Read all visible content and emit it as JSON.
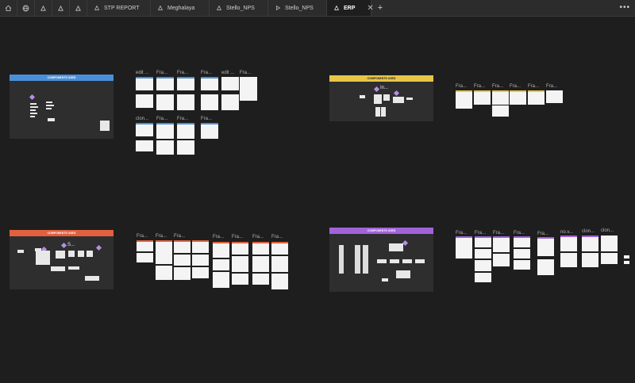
{
  "tabbar": {
    "icons": [
      "home-icon",
      "globe-icon",
      "figma-file-icon",
      "figma-file-icon",
      "figma-file-icon"
    ],
    "tabs": [
      {
        "label": "STP REPORT",
        "icon": "figma-file-icon"
      },
      {
        "label": "Meghalaya",
        "icon": "figma-file-icon"
      },
      {
        "label": "Stello_NPS",
        "icon": "figma-file-icon"
      },
      {
        "label": "Stello_NPS",
        "icon": "prototype-play-icon"
      },
      {
        "label": "ERP",
        "icon": "figma-file-icon",
        "active": true
      }
    ],
    "close_glyph": "✕",
    "new_tab_glyph": "+",
    "more_glyph": "•••"
  },
  "boards": [
    {
      "title": "COMPONENTS USED",
      "color": "#4a90d9"
    },
    {
      "title": "COMPONENTS USED",
      "color": "#e8c547"
    },
    {
      "title": "COMPONENTS USED",
      "color": "#e2603f"
    },
    {
      "title": "COMPONENTS USED",
      "color": "#a163d9"
    }
  ],
  "board_texts": {
    "in": "In...",
    "s": "S..."
  },
  "frame_labels": {
    "q1_row1": [
      "edit ...",
      "Fra...",
      "Fra...",
      "Fra...",
      "edit ...",
      "Fra..."
    ],
    "q1_row2": [
      "clon...",
      "Fra...",
      "Fra...",
      "Fra..."
    ],
    "q2_row1": [
      "Fra...",
      "Fra...",
      "Fra...",
      "Fra...",
      "Fra...",
      "Fra..."
    ],
    "q3_row1": [
      "Fra...",
      "Fra...",
      "Fra...",
      "Fra...",
      "Fra...",
      "Fra...",
      "Fra..."
    ],
    "q4_row1": [
      "Fra...",
      "Fra...",
      "Fra...",
      "Fra...",
      "Fra...",
      "no.v...",
      "clon...",
      "clon..."
    ]
  },
  "colors": {
    "blue": "#4a90d9",
    "yellow": "#e8c547",
    "orange": "#e2603f",
    "purple": "#a163d9"
  }
}
